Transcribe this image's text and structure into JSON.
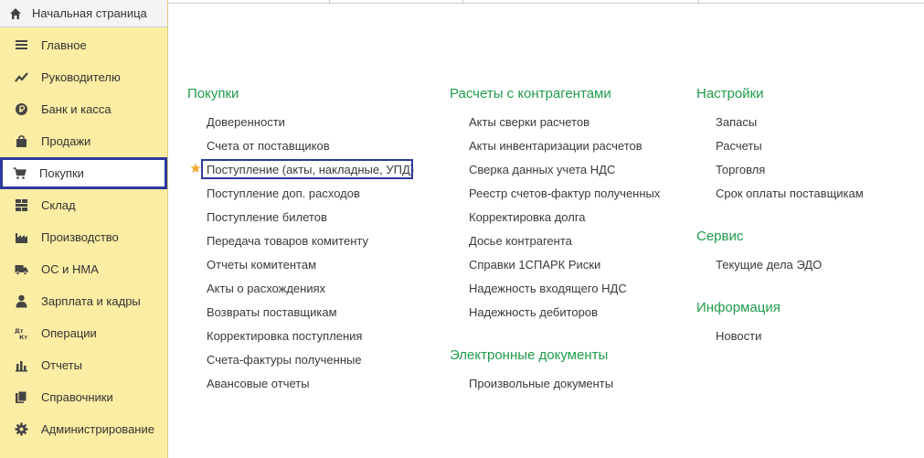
{
  "home": {
    "label": "Начальная страница",
    "icon": "home-icon"
  },
  "sidebar": {
    "items": [
      {
        "label": "Главное",
        "icon": "menu-lines-icon"
      },
      {
        "label": "Руководителю",
        "icon": "trend-chart-icon"
      },
      {
        "label": "Банк и касса",
        "icon": "ruble-coin-icon"
      },
      {
        "label": "Продажи",
        "icon": "shopping-bag-icon"
      },
      {
        "label": "Покупки",
        "icon": "shopping-cart-icon",
        "active": true
      },
      {
        "label": "Склад",
        "icon": "warehouse-grid-icon"
      },
      {
        "label": "Производство",
        "icon": "factory-icon"
      },
      {
        "label": "ОС и НМА",
        "icon": "truck-icon"
      },
      {
        "label": "Зарплата и кадры",
        "icon": "person-icon"
      },
      {
        "label": "Операции",
        "icon": "dt-kt-icon",
        "icon_text": "Дт Кт"
      },
      {
        "label": "Отчеты",
        "icon": "bar-chart-icon"
      },
      {
        "label": "Справочники",
        "icon": "books-icon"
      },
      {
        "label": "Администрирование",
        "icon": "gear-icon"
      }
    ]
  },
  "content": {
    "purchases": {
      "title": "Покупки",
      "items": [
        "Доверенности",
        "Счета от поставщиков",
        "Поступление (акты, накладные, УПД)",
        "Поступление доп. расходов",
        "Поступление билетов",
        "Передача товаров комитенту",
        "Отчеты комитентам",
        "Акты о расхождениях",
        "Возвраты поставщикам",
        "Корректировка поступления",
        "Счета-фактуры полученные",
        "Авансовые отчеты"
      ]
    },
    "settlements": {
      "title": "Расчеты с контрагентами",
      "items": [
        "Акты сверки расчетов",
        "Акты инвентаризации расчетов",
        "Сверка данных учета НДС",
        "Реестр счетов-фактур полученных",
        "Корректировка долга",
        "Досье контрагента",
        "Справки 1СПАРК Риски",
        "Надежность входящего НДС",
        "Надежность дебиторов"
      ]
    },
    "edocs": {
      "title": "Электронные документы",
      "items": [
        "Произвольные документы"
      ]
    },
    "settings": {
      "title": "Настройки",
      "items": [
        "Запасы",
        "Расчеты",
        "Торговля",
        "Срок оплаты поставщикам"
      ]
    },
    "service": {
      "title": "Сервис",
      "items": [
        "Текущие дела ЭДО"
      ]
    },
    "info": {
      "title": "Информация",
      "items": [
        "Новости"
      ]
    }
  },
  "favorite": {
    "icon": "star-icon",
    "color": "#f0a830"
  },
  "colors": {
    "sidebar_bg": "#fbeda3",
    "section_title": "#1f9c4a",
    "highlight_border": "#2c3a9e"
  }
}
